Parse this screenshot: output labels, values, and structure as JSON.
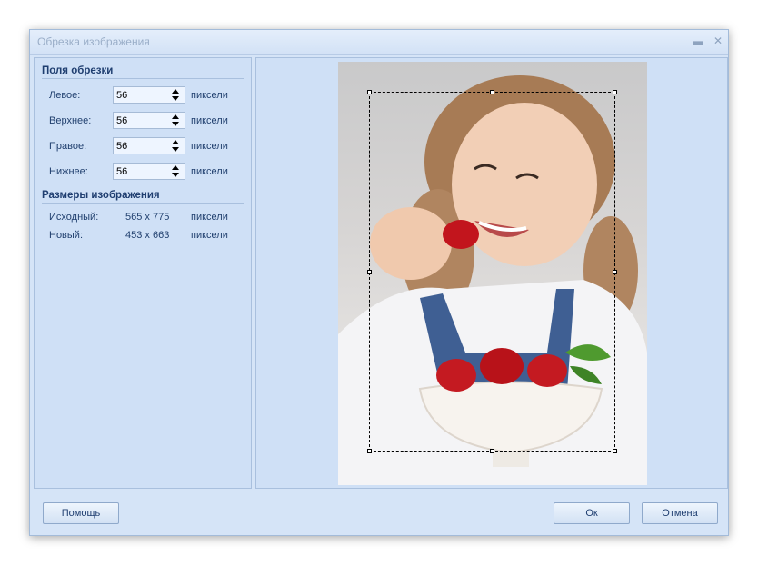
{
  "window": {
    "title": "Обрезка изображения",
    "minimize_icon": "minimize-icon",
    "close_icon": "close-icon"
  },
  "margins": {
    "header": "Поля обрезки",
    "rows": [
      {
        "label": "Левое:",
        "value": "56",
        "unit": "пиксели"
      },
      {
        "label": "Верхнее:",
        "value": "56",
        "unit": "пиксели"
      },
      {
        "label": "Правое:",
        "value": "56",
        "unit": "пиксели"
      },
      {
        "label": "Нижнее:",
        "value": "56",
        "unit": "пиксели"
      }
    ]
  },
  "size": {
    "header": "Размеры изображения",
    "original": {
      "label": "Исходный:",
      "value": "565 x 775",
      "unit": "пиксели"
    },
    "new": {
      "label": "Новый:",
      "value": "453 x 663",
      "unit": "пиксели"
    }
  },
  "buttons": {
    "help": "Помощь",
    "ok": "Ок",
    "cancel": "Отмена"
  },
  "colors": {
    "dialog_bg": "#d5e4f7",
    "panel_border": "#a9c0de",
    "text": "#1e3f73"
  }
}
